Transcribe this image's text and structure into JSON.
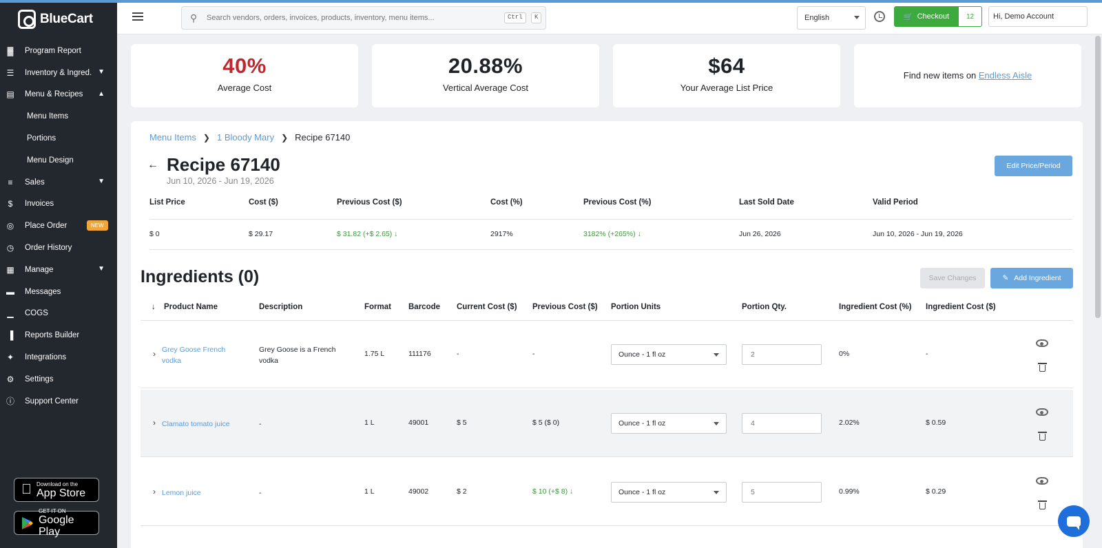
{
  "app": {
    "brand": "BlueCart"
  },
  "sidebar": {
    "items": [
      {
        "label": "Program Report",
        "icon": "bar-chart-icon"
      },
      {
        "label": "Inventory & Ingred.",
        "icon": "list-icon",
        "expandable": true
      },
      {
        "label": "Menu & Recipes",
        "icon": "book-icon",
        "expanded": true
      },
      {
        "label": "Menu Items",
        "sub": true
      },
      {
        "label": "Portions",
        "sub": true
      },
      {
        "label": "Menu Design",
        "sub": true
      },
      {
        "label": "Sales",
        "icon": "stack-icon",
        "expandable": true
      },
      {
        "label": "Invoices",
        "icon": "dollar-icon"
      },
      {
        "label": "Place Order",
        "icon": "cart-icon",
        "badge": "NEW"
      },
      {
        "label": "Order History",
        "icon": "clock-icon"
      },
      {
        "label": "Manage",
        "icon": "manage-icon",
        "expandable": true
      },
      {
        "label": "Messages",
        "icon": "chat-icon"
      },
      {
        "label": "COGS",
        "icon": "bars-icon"
      },
      {
        "label": "Reports Builder",
        "icon": "report-icon"
      },
      {
        "label": "Integrations",
        "icon": "puzzle-icon"
      },
      {
        "label": "Settings",
        "icon": "gear-icon"
      },
      {
        "label": "Support Center",
        "icon": "info-icon"
      }
    ],
    "app_store": {
      "small": "Download on the",
      "large": "App Store"
    },
    "google_play": {
      "small": "GET IT ON",
      "large": "Google Play"
    }
  },
  "header": {
    "search_placeholder": "Search vendors, orders, invoices, products, inventory, menu items...",
    "kbd1": "Ctrl",
    "kbd2": "K",
    "language": "English",
    "checkout_label": "Checkout",
    "cart_count": "12",
    "account": "Hi, Demo Account"
  },
  "stats": {
    "avg_cost": {
      "value": "40%",
      "label": "Average Cost",
      "color": "#c0282d"
    },
    "vertical_avg_cost": {
      "value": "20.88%",
      "label": "Vertical Average Cost"
    },
    "avg_list_price": {
      "value": "$64",
      "label": "Your Average List Price"
    },
    "endless_aisle": {
      "text": "Find new items on ",
      "link": "Endless Aisle"
    }
  },
  "breadcrumb": {
    "menu_items": "Menu Items",
    "item": "1 Bloody Mary",
    "current": "Recipe 67140"
  },
  "recipe": {
    "title": "Recipe 67140",
    "period": "Jun 10, 2026 - Jun 19, 2026",
    "edit_button": "Edit Price/Period",
    "summary_headers": [
      "List Price",
      "Cost ($)",
      "Previous Cost ($)",
      "Cost (%)",
      "Previous Cost (%)",
      "Last Sold Date",
      "Valid Period"
    ],
    "summary_values": [
      "$ 0",
      "$ 29.17",
      "$ 31.82 (+$ 2.65) ↓",
      "2917%",
      "3182% (+265%) ↓",
      "Jun 26, 2026",
      "Jun 10, 2026 - Jun 19, 2026"
    ]
  },
  "ingredients": {
    "title": "Ingredients (0)",
    "save_button": "Save Changes",
    "add_button": "Add Ingredient",
    "headers": [
      "Product Name",
      "Description",
      "Format",
      "Barcode",
      "Current Cost ($)",
      "Previous Cost ($)",
      "Portion Units",
      "Portion Qty.",
      "Ingredient Cost (%)",
      "Ingredient Cost ($)"
    ],
    "rows": [
      {
        "name": "Grey Goose French vodka",
        "description": "Grey Goose is a French vodka",
        "format": "1.75 L",
        "barcode": "111176",
        "current_cost": "-",
        "previous_cost": "-",
        "previous_green": false,
        "unit": "Ounce - 1 fl oz",
        "qty": "2",
        "cost_pct": "0%",
        "cost_usd": "-"
      },
      {
        "name": "Clamato tomato juice",
        "description": "-",
        "format": "1 L",
        "barcode": "49001",
        "current_cost": "$ 5",
        "previous_cost": "$ 5 ($ 0)",
        "previous_green": false,
        "unit": "Ounce - 1 fl oz",
        "qty": "4",
        "cost_pct": "2.02%",
        "cost_usd": "$ 0.59"
      },
      {
        "name": "Lemon juice",
        "description": "-",
        "format": "1 L",
        "barcode": "49002",
        "current_cost": "$ 2",
        "previous_cost": "$ 10 (+$ 8) ↓",
        "previous_green": true,
        "unit": "Ounce - 1 fl oz",
        "qty": "5",
        "cost_pct": "0.99%",
        "cost_usd": "$ 0.29"
      }
    ]
  },
  "colors": {
    "sidebar": "#23272e",
    "accent": "#5b9bd5",
    "checkout": "#3daa3d",
    "positive": "#3a9a3a"
  }
}
